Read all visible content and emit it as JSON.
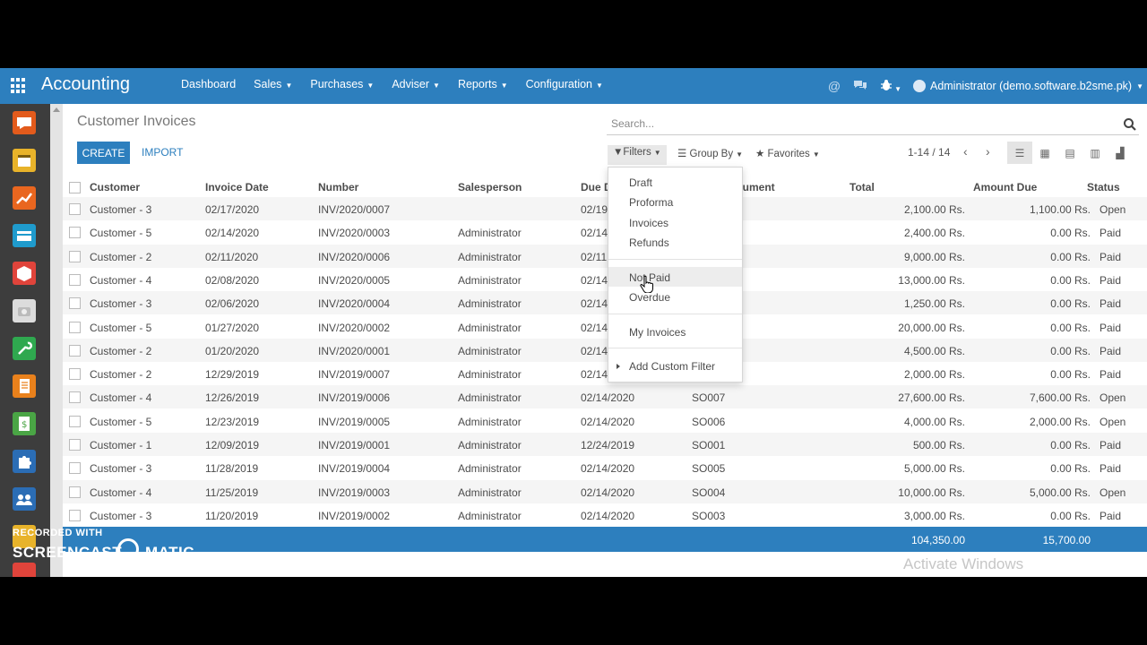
{
  "navbar": {
    "brand": "Accounting",
    "menu": [
      {
        "label": "Dashboard",
        "dropdown": false
      },
      {
        "label": "Sales",
        "dropdown": true
      },
      {
        "label": "Purchases",
        "dropdown": true
      },
      {
        "label": "Adviser",
        "dropdown": true
      },
      {
        "label": "Reports",
        "dropdown": true
      },
      {
        "label": "Configuration",
        "dropdown": true
      }
    ],
    "user": "Administrator (demo.software.b2sme.pk)"
  },
  "control_panel": {
    "breadcrumb": "Customer Invoices",
    "create_label": "CREATE",
    "import_label": "IMPORT",
    "search_placeholder": "Search...",
    "filters_label": "Filters",
    "groupby_label": "Group By",
    "favorites_label": "Favorites",
    "pager": "1-14 / 14"
  },
  "filters_menu": {
    "items": [
      "Draft",
      "Proforma",
      "Invoices",
      "Refunds",
      "Not Paid",
      "Overdue",
      "My Invoices"
    ],
    "custom": "Add Custom Filter",
    "hovered": "Not Paid"
  },
  "table": {
    "headers": {
      "customer": "Customer",
      "invoice_date": "Invoice Date",
      "number": "Number",
      "salesperson": "Salesperson",
      "due_date": "Due D",
      "source": "cument",
      "total": "Total",
      "amount_due": "Amount Due",
      "status": "Status"
    },
    "rows": [
      {
        "customer": "Customer - 3",
        "date": "02/17/2020",
        "number": "INV/2020/0007",
        "salesperson": "",
        "due": "02/19",
        "source": "",
        "total": "2,100.00 Rs.",
        "amount_due": "1,100.00 Rs.",
        "status": "Open"
      },
      {
        "customer": "Customer - 5",
        "date": "02/14/2020",
        "number": "INV/2020/0003",
        "salesperson": "Administrator",
        "due": "02/14",
        "source": "",
        "total": "2,400.00 Rs.",
        "amount_due": "0.00 Rs.",
        "status": "Paid"
      },
      {
        "customer": "Customer - 2",
        "date": "02/11/2020",
        "number": "INV/2020/0006",
        "salesperson": "Administrator",
        "due": "02/11",
        "source": "",
        "total": "9,000.00 Rs.",
        "amount_due": "0.00 Rs.",
        "status": "Paid"
      },
      {
        "customer": "Customer - 4",
        "date": "02/08/2020",
        "number": "INV/2020/0005",
        "salesperson": "Administrator",
        "due": "02/14",
        "source": "",
        "total": "13,000.00 Rs.",
        "amount_due": "0.00 Rs.",
        "status": "Paid"
      },
      {
        "customer": "Customer - 3",
        "date": "02/06/2020",
        "number": "INV/2020/0004",
        "salesperson": "Administrator",
        "due": "02/14",
        "source": "",
        "total": "1,250.00 Rs.",
        "amount_due": "0.00 Rs.",
        "status": "Paid"
      },
      {
        "customer": "Customer - 5",
        "date": "01/27/2020",
        "number": "INV/2020/0002",
        "salesperson": "Administrator",
        "due": "02/14",
        "source": "",
        "total": "20,000.00 Rs.",
        "amount_due": "0.00 Rs.",
        "status": "Paid"
      },
      {
        "customer": "Customer - 2",
        "date": "01/20/2020",
        "number": "INV/2020/0001",
        "salesperson": "Administrator",
        "due": "02/14",
        "source": "",
        "total": "4,500.00 Rs.",
        "amount_due": "0.00 Rs.",
        "status": "Paid"
      },
      {
        "customer": "Customer - 2",
        "date": "12/29/2019",
        "number": "INV/2019/0007",
        "salesperson": "Administrator",
        "due": "02/14",
        "source": "",
        "total": "2,000.00 Rs.",
        "amount_due": "0.00 Rs.",
        "status": "Paid"
      },
      {
        "customer": "Customer - 4",
        "date": "12/26/2019",
        "number": "INV/2019/0006",
        "salesperson": "Administrator",
        "due": "02/14/2020",
        "source": "SO007",
        "total": "27,600.00 Rs.",
        "amount_due": "7,600.00 Rs.",
        "status": "Open"
      },
      {
        "customer": "Customer - 5",
        "date": "12/23/2019",
        "number": "INV/2019/0005",
        "salesperson": "Administrator",
        "due": "02/14/2020",
        "source": "SO006",
        "total": "4,000.00 Rs.",
        "amount_due": "2,000.00 Rs.",
        "status": "Open"
      },
      {
        "customer": "Customer - 1",
        "date": "12/09/2019",
        "number": "INV/2019/0001",
        "salesperson": "Administrator",
        "due": "12/24/2019",
        "source": "SO001",
        "total": "500.00 Rs.",
        "amount_due": "0.00 Rs.",
        "status": "Paid"
      },
      {
        "customer": "Customer - 3",
        "date": "11/28/2019",
        "number": "INV/2019/0004",
        "salesperson": "Administrator",
        "due": "02/14/2020",
        "source": "SO005",
        "total": "5,000.00 Rs.",
        "amount_due": "0.00 Rs.",
        "status": "Paid"
      },
      {
        "customer": "Customer - 4",
        "date": "11/25/2019",
        "number": "INV/2019/0003",
        "salesperson": "Administrator",
        "due": "02/14/2020",
        "source": "SO004",
        "total": "10,000.00 Rs.",
        "amount_due": "5,000.00 Rs.",
        "status": "Open"
      },
      {
        "customer": "Customer - 3",
        "date": "11/20/2019",
        "number": "INV/2019/0002",
        "salesperson": "Administrator",
        "due": "02/14/2020",
        "source": "SO003",
        "total": "3,000.00 Rs.",
        "amount_due": "0.00 Rs.",
        "status": "Paid"
      }
    ],
    "footer": {
      "total": "104,350.00",
      "amount_due": "15,700.00"
    }
  },
  "overlays": {
    "activate_windows": "Activate Windows",
    "recorded_with": "RECORDED WITH",
    "screencast_a": "SCREENCAST",
    "screencast_b": "MATIC"
  },
  "dock_icons": [
    "chat-icon",
    "calendar-icon",
    "chart-icon",
    "card-icon",
    "box-icon",
    "camera-icon",
    "wrench-icon",
    "document-icon",
    "spreadsheet-icon",
    "puzzle-icon",
    "team-icon"
  ],
  "colors": {
    "brand": "#2d7fbe",
    "dock": "#3d3d3d"
  }
}
